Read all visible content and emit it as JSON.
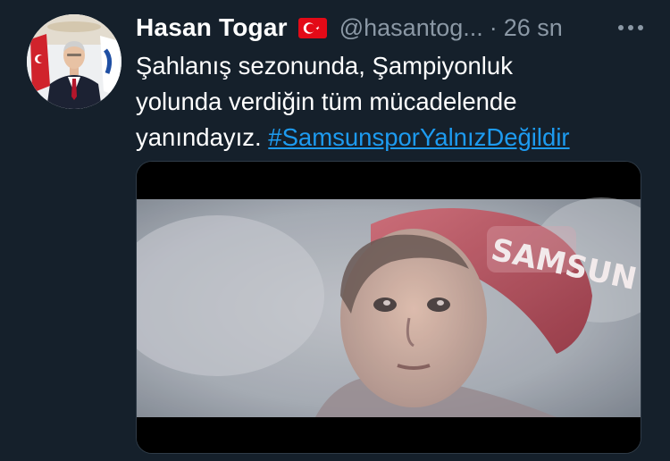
{
  "tweet": {
    "author_name": "Hasan Togar",
    "author_flag": "turkey-flag-icon",
    "handle": "@hasantog...",
    "separator": "·",
    "time": "26 sn",
    "text_lines": [
      "Şahlanış sezonunda, Şampiyonluk",
      "yolunda verdiğin tüm mücadelende",
      "yanındayız. "
    ],
    "hashtag": "#SamsunsporYalnızDeğildir",
    "media": {
      "type": "video",
      "caption_on_hat": "SAMSUN"
    }
  },
  "colors": {
    "background": "#15202b",
    "text": "#ffffff",
    "secondary": "#8b98a5",
    "link": "#1d9bf0"
  }
}
